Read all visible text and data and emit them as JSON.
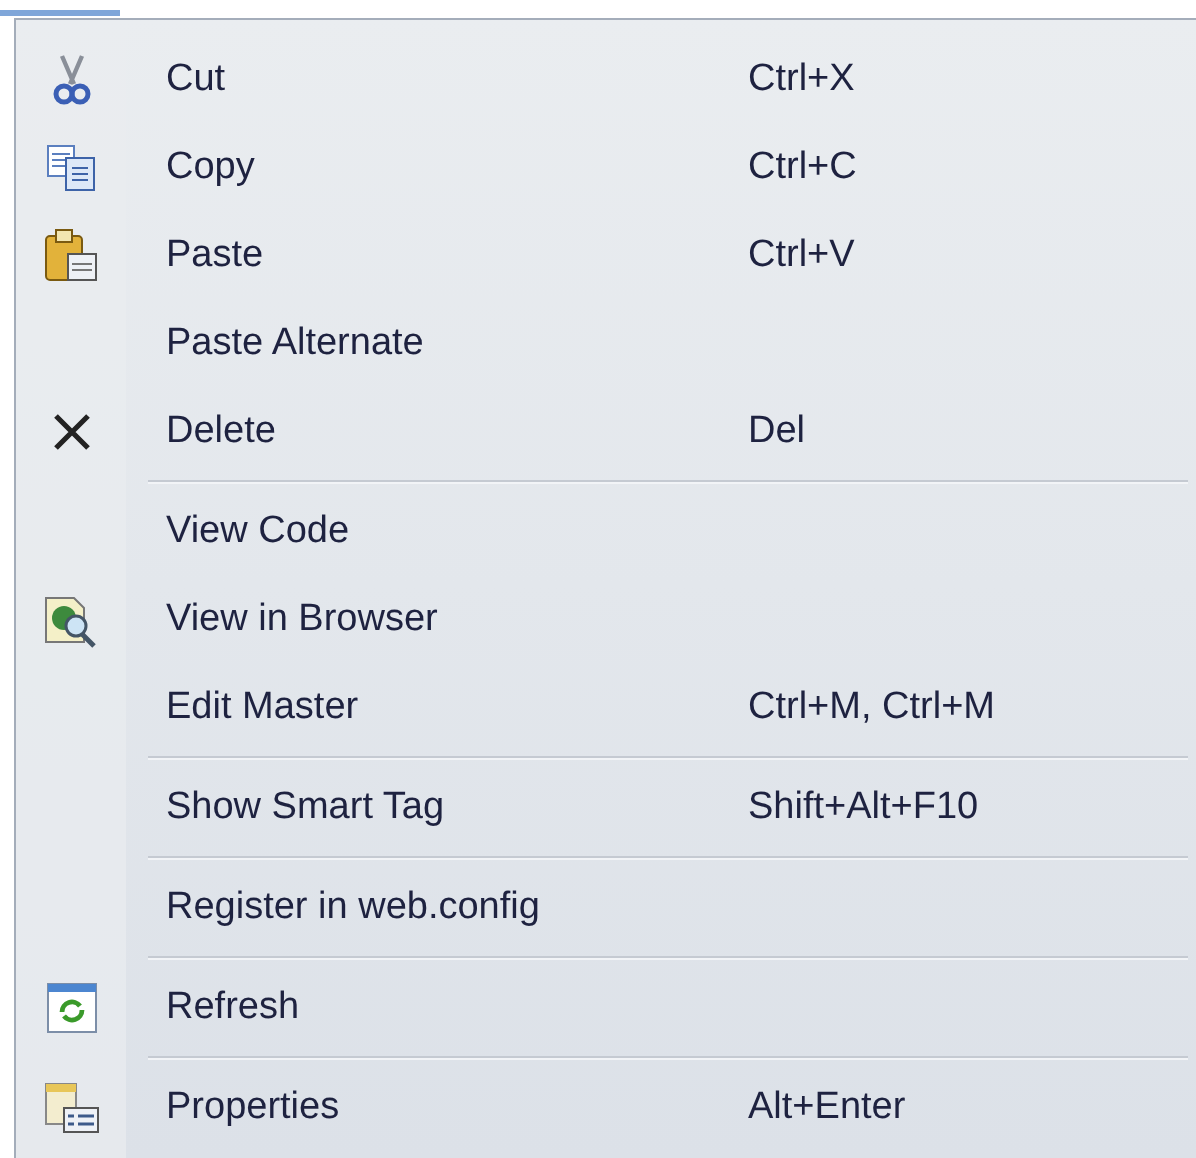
{
  "menu_groups": [
    [
      {
        "label": "Cut",
        "shortcut": "Ctrl+X"
      },
      {
        "label": "Copy",
        "shortcut": "Ctrl+C"
      },
      {
        "label": "Paste",
        "shortcut": "Ctrl+V"
      },
      {
        "label": "Paste Alternate"
      },
      {
        "label": "Delete",
        "shortcut": "Del"
      }
    ],
    [
      {
        "label": "View Code"
      },
      {
        "label": "View in Browser"
      },
      {
        "label": "Edit Master",
        "shortcut": "Ctrl+M, Ctrl+M"
      }
    ],
    [
      {
        "label": "Show Smart Tag",
        "shortcut": "Shift+Alt+F10"
      }
    ],
    [
      {
        "label": "Register in web.config"
      }
    ],
    [
      {
        "label": "Refresh"
      }
    ],
    [
      {
        "label": "Properties",
        "shortcut": "Alt+Enter"
      }
    ]
  ]
}
